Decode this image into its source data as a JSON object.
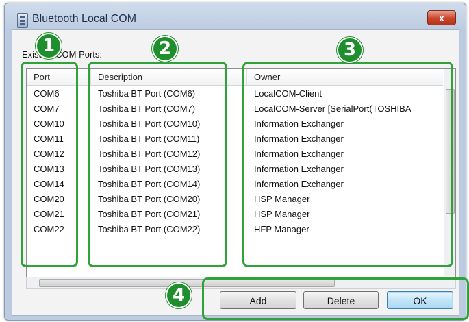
{
  "window": {
    "title": "Bluetooth Local COM",
    "close_label": "x"
  },
  "section_label": "Existing COM Ports:",
  "table": {
    "headers": [
      "Port",
      "Description",
      "Owner"
    ],
    "rows": [
      [
        "COM6",
        "Toshiba BT Port (COM6)",
        "LocalCOM-Client"
      ],
      [
        "COM7",
        "Toshiba BT Port (COM7)",
        "LocalCOM-Server [SerialPort(TOSHIBA"
      ],
      [
        "COM10",
        "Toshiba BT Port (COM10)",
        "Information Exchanger"
      ],
      [
        "COM11",
        "Toshiba BT Port (COM11)",
        "Information Exchanger"
      ],
      [
        "COM12",
        "Toshiba BT Port (COM12)",
        "Information Exchanger"
      ],
      [
        "COM13",
        "Toshiba BT Port (COM13)",
        "Information Exchanger"
      ],
      [
        "COM14",
        "Toshiba BT Port (COM14)",
        "Information Exchanger"
      ],
      [
        "COM20",
        "Toshiba BT Port (COM20)",
        "HSP Manager"
      ],
      [
        "COM21",
        "Toshiba BT Port (COM21)",
        "HSP Manager"
      ],
      [
        "COM22",
        "Toshiba BT Port (COM22)",
        "HFP Manager"
      ]
    ]
  },
  "buttons": {
    "add": "Add",
    "delete": "Delete",
    "ok": "OK"
  },
  "callouts": [
    "1",
    "2",
    "3",
    "4"
  ],
  "colors": {
    "callout_green": "#2fa33a",
    "badge_green": "#1f8e2c",
    "close_red": "#c9452c"
  }
}
